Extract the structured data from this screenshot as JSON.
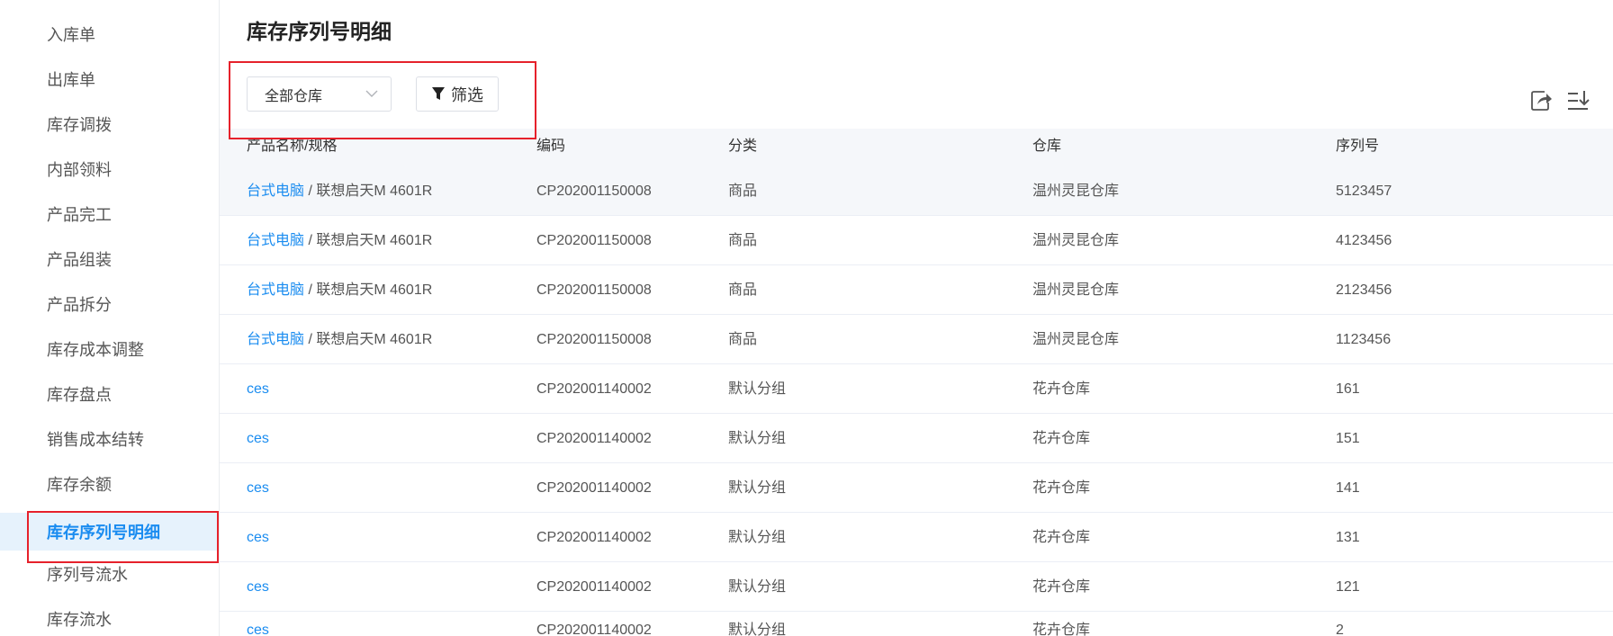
{
  "sidebar": {
    "items": [
      {
        "label": "入库单"
      },
      {
        "label": "出库单"
      },
      {
        "label": "库存调拨"
      },
      {
        "label": "内部领料"
      },
      {
        "label": "产品完工"
      },
      {
        "label": "产品组装"
      },
      {
        "label": "产品拆分"
      },
      {
        "label": "库存成本调整"
      },
      {
        "label": "库存盘点"
      },
      {
        "label": "销售成本结转"
      },
      {
        "label": "库存余额"
      },
      {
        "label": "库存序列号明细"
      },
      {
        "label": "序列号流水"
      },
      {
        "label": "库存流水"
      }
    ],
    "active_index": 11
  },
  "page": {
    "title": "库存序列号明细"
  },
  "toolbar": {
    "warehouse_select": {
      "value": "全部仓库",
      "icon": "chevron-down-icon"
    },
    "filter_label": "筛选",
    "filter_icon": "funnel-icon",
    "export_icon": "export-icon",
    "sort_icon": "sort-icon"
  },
  "table": {
    "columns": [
      "产品名称/规格",
      "编码",
      "分类",
      "仓库",
      "序列号"
    ],
    "rows": [
      {
        "name": "台式电脑",
        "spec": "联想启天M 4601R",
        "code": "CP202001150008",
        "category": "商品",
        "warehouse": "温州灵昆仓库",
        "serial": "5123457"
      },
      {
        "name": "台式电脑",
        "spec": "联想启天M 4601R",
        "code": "CP202001150008",
        "category": "商品",
        "warehouse": "温州灵昆仓库",
        "serial": "4123456"
      },
      {
        "name": "台式电脑",
        "spec": "联想启天M 4601R",
        "code": "CP202001150008",
        "category": "商品",
        "warehouse": "温州灵昆仓库",
        "serial": "2123456"
      },
      {
        "name": "台式电脑",
        "spec": "联想启天M 4601R",
        "code": "CP202001150008",
        "category": "商品",
        "warehouse": "温州灵昆仓库",
        "serial": "1123456"
      },
      {
        "name": "ces",
        "spec": "",
        "code": "CP202001140002",
        "category": "默认分组",
        "warehouse": "花卉仓库",
        "serial": "161"
      },
      {
        "name": "ces",
        "spec": "",
        "code": "CP202001140002",
        "category": "默认分组",
        "warehouse": "花卉仓库",
        "serial": "151"
      },
      {
        "name": "ces",
        "spec": "",
        "code": "CP202001140002",
        "category": "默认分组",
        "warehouse": "花卉仓库",
        "serial": "141"
      },
      {
        "name": "ces",
        "spec": "",
        "code": "CP202001140002",
        "category": "默认分组",
        "warehouse": "花卉仓库",
        "serial": "131"
      },
      {
        "name": "ces",
        "spec": "",
        "code": "CP202001140002",
        "category": "默认分组",
        "warehouse": "花卉仓库",
        "serial": "121"
      },
      {
        "name": "ces",
        "spec": "",
        "code": "CP202001140002",
        "category": "默认分组",
        "warehouse": "花卉仓库",
        "serial": "2"
      }
    ]
  },
  "colors": {
    "accent": "#1a8cf0",
    "annotation": "#e6212b"
  }
}
